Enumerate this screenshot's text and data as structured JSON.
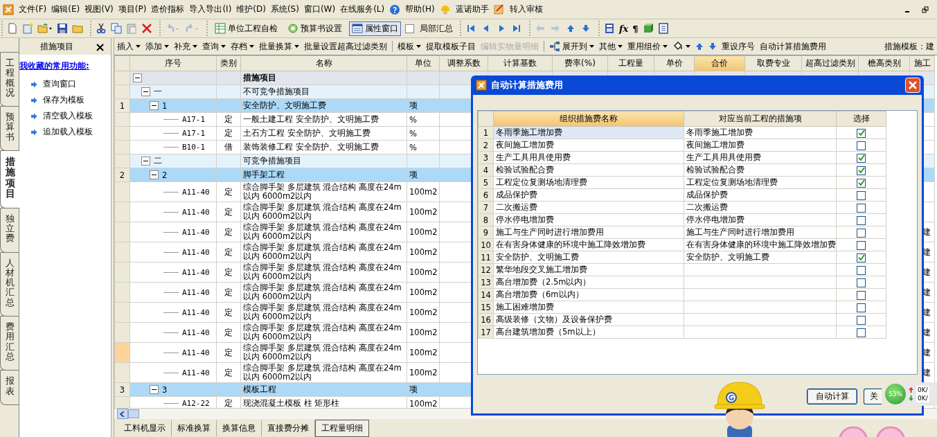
{
  "menu": {
    "items": [
      "文件(F)",
      "编辑(E)",
      "视图(V)",
      "项目(P)",
      "造价指标",
      "导入导出(I)",
      "维护(D)",
      "系统(S)",
      "窗口(W)",
      "在线服务(L)"
    ],
    "help": "帮助(H)",
    "assistant": "蓝诺助手",
    "review": "转入审核"
  },
  "toolbar": {
    "undo": {
      "disabled": true
    },
    "redo": {
      "disabled": true
    },
    "buttons": [
      {
        "label": "单位工程自检",
        "pressed": false
      },
      {
        "label": "预算书设置",
        "pressed": false
      },
      {
        "label": "属性窗口",
        "pressed": true
      }
    ],
    "summary_checkbox": {
      "label": "局部汇总",
      "checked": false
    },
    "back": {
      "disabled": true
    },
    "forward": {
      "disabled": true
    },
    "glyphs": [
      "fx",
      "¶"
    ]
  },
  "side_tabs": [
    {
      "label": "工程概况",
      "selected": false
    },
    {
      "label": "预算书",
      "selected": false
    },
    {
      "label": "措施项目",
      "selected": true
    },
    {
      "label": "独立费",
      "selected": false
    },
    {
      "label": "人材机汇总",
      "selected": false
    },
    {
      "label": "费用汇总",
      "selected": false
    },
    {
      "label": "报表",
      "selected": false
    }
  ],
  "left_panel": {
    "title": "措施项目",
    "close": "×",
    "heading": "我收藏的常用功能:",
    "items": [
      "查询窗口",
      "保存为模板",
      "清空载入模板",
      "追加载入模板"
    ]
  },
  "main_toolbar": {
    "items": [
      {
        "kind": "text",
        "label": "插入",
        "menu": true,
        "disabled": false
      },
      {
        "kind": "text",
        "label": "添加",
        "menu": true,
        "disabled": false
      },
      {
        "kind": "text",
        "label": "补充",
        "menu": true,
        "disabled": false
      },
      {
        "kind": "text",
        "label": "查询",
        "menu": true,
        "disabled": false
      },
      {
        "kind": "text",
        "label": "存档",
        "menu": true,
        "disabled": false
      },
      {
        "kind": "text",
        "label": "批量换算",
        "menu": true,
        "disabled": false
      },
      {
        "kind": "text",
        "label": "批量设置超高过滤类别",
        "menu": false,
        "disabled": false
      },
      {
        "kind": "text",
        "label": "模板",
        "menu": true,
        "disabled": false
      },
      {
        "kind": "text",
        "label": "提取模板子目",
        "menu": false,
        "disabled": false
      },
      {
        "kind": "text",
        "label": "编辑实物量明细",
        "menu": false,
        "disabled": true
      },
      {
        "kind": "tree",
        "label": "展开到",
        "menu": true,
        "disabled": false
      },
      {
        "kind": "text",
        "label": "其他",
        "menu": true,
        "disabled": false
      },
      {
        "kind": "text",
        "label": "重用组价",
        "menu": true,
        "disabled": false
      },
      {
        "kind": "fill",
        "menu": true,
        "disabled": false
      },
      {
        "kind": "up",
        "menu": false,
        "disabled": false
      },
      {
        "kind": "down",
        "menu": false,
        "disabled": false
      },
      {
        "kind": "text",
        "label": "重设序号",
        "menu": false,
        "disabled": false
      },
      {
        "kind": "text",
        "label": "自动计算措施费用",
        "menu": false,
        "disabled": false
      }
    ],
    "template_label": "措施模板：建"
  },
  "table": {
    "columns": [
      {
        "label": "序号",
        "selected": false
      },
      {
        "label": "类别",
        "selected": false
      },
      {
        "label": "名称",
        "selected": false
      },
      {
        "label": "单位",
        "selected": false
      },
      {
        "label": "调整系数",
        "selected": false
      },
      {
        "label": "计算基数",
        "selected": false
      },
      {
        "label": "费率(%)",
        "selected": false
      },
      {
        "label": "工程量",
        "selected": false
      },
      {
        "label": "单价",
        "selected": false
      },
      {
        "label": "合价",
        "selected": true
      },
      {
        "label": "取费专业",
        "selected": false
      },
      {
        "label": "超高过滤类别",
        "selected": false
      },
      {
        "label": "檐高类别",
        "selected": false
      },
      {
        "label": "施工",
        "selected": false
      }
    ],
    "rows": [
      {
        "name": "措施项目",
        "expanded": true,
        "selected": false,
        "children": [
          {
            "code": "一",
            "name": "不可竞争措施项目",
            "expanded": true,
            "selected": false,
            "children": [
              {
                "index": "1",
                "code": "1",
                "name": "安全防护、文明施工费",
                "unit": "项",
                "expanded": true,
                "selected": false,
                "children": [
                  {
                    "code": "A17-1",
                    "type": "定",
                    "name": "一般土建工程 安全防护、文明施工费",
                    "unit": "%",
                    "selected": false
                  },
                  {
                    "code": "A17-1",
                    "type": "定",
                    "name": "土石方工程 安全防护、文明施工费",
                    "unit": "%",
                    "selected": false
                  },
                  {
                    "code": "B10-1",
                    "type": "借",
                    "name": "装饰装修工程 安全防护、文明施工费",
                    "unit": "%",
                    "selected": false
                  }
                ]
              }
            ]
          },
          {
            "code": "二",
            "name": "可竞争措施项目",
            "expanded": true,
            "selected": false,
            "children": [
              {
                "index": "2",
                "code": "2",
                "name": "脚手架工程",
                "unit": "项",
                "expanded": true,
                "selected": false,
                "children": [
                  {
                    "code": "A11-40",
                    "type": "定",
                    "name": "综合脚手架 多层建筑 混合结构 高度在24m以内 6000m2以内",
                    "unit": "100m2",
                    "selected": false
                  },
                  {
                    "code": "A11-40",
                    "type": "定",
                    "name": "综合脚手架 多层建筑 混合结构 高度在24m以内 6000m2以内",
                    "unit": "100m2",
                    "selected": false
                  },
                  {
                    "code": "A11-40",
                    "type": "定",
                    "name": "综合脚手架 多层建筑 混合结构 高度在24m以内 6000m2以内",
                    "unit": "100m2",
                    "selected": false,
                    "column_14": "建"
                  },
                  {
                    "code": "A11-40",
                    "type": "定",
                    "name": "综合脚手架 多层建筑 混合结构 高度在24m以内 6000m2以内",
                    "unit": "100m2",
                    "selected": false,
                    "column_14": "建"
                  },
                  {
                    "code": "A11-40",
                    "type": "定",
                    "name": "综合脚手架 多层建筑 混合结构 高度在24m以内 6000m2以内",
                    "unit": "100m2",
                    "selected": false,
                    "column_14": "建"
                  },
                  {
                    "code": "A11-40",
                    "type": "定",
                    "name": "综合脚手架 多层建筑 混合结构 高度在24m以内 6000m2以内",
                    "unit": "100m2",
                    "selected": false,
                    "column_14": "建"
                  },
                  {
                    "code": "A11-40",
                    "type": "定",
                    "name": "综合脚手架 多层建筑 混合结构 高度在24m以内 6000m2以内",
                    "unit": "100m2",
                    "selected": false,
                    "column_14": "建"
                  },
                  {
                    "code": "A11-40",
                    "type": "定",
                    "name": "综合脚手架 多层建筑 混合结构 高度在24m以内 6000m2以内",
                    "unit": "100m2",
                    "selected": false,
                    "column_14": "建"
                  },
                  {
                    "code": "A11-40",
                    "type": "定",
                    "name": "综合脚手架 多层建筑 混合结构 高度在24m以内 6000m2以内",
                    "unit": "100m2",
                    "selected": true,
                    "column_14": "建"
                  },
                  {
                    "code": "A11-40",
                    "type": "定",
                    "name": "综合脚手架 多层建筑 混合结构 高度在24m以内 6000m2以内",
                    "unit": "100m2",
                    "selected": false,
                    "column_14": "建"
                  }
                ]
              },
              {
                "index": "3",
                "code": "3",
                "name": "模板工程",
                "unit": "项",
                "expanded": true,
                "selected": false,
                "children": [
                  {
                    "code": "A12-22",
                    "type": "定",
                    "name": "现浇混凝土模板 柱 矩形柱",
                    "unit": "100m2",
                    "selected": false
                  }
                ]
              }
            ]
          }
        ]
      }
    ]
  },
  "bottom_tabs": [
    {
      "label": "工料机显示",
      "selected": false
    },
    {
      "label": "标准换算",
      "selected": false
    },
    {
      "label": "换算信息",
      "selected": false
    },
    {
      "label": "直接费分摊",
      "selected": false
    },
    {
      "label": "工程量明细",
      "selected": true
    }
  ],
  "dialog": {
    "title": "自动计算措施费用",
    "columns": [
      {
        "label": "组织措施费名称",
        "selected": true
      },
      {
        "label": "对应当前工程的措施项",
        "selected": false
      },
      {
        "label": "选择",
        "selected": false
      }
    ],
    "rows": [
      {
        "no": "1",
        "name": "冬雨季施工增加费",
        "item": "冬雨季施工增加费",
        "checked": true,
        "selected": true
      },
      {
        "no": "2",
        "name": "夜间施工增加费",
        "item": "夜间施工增加费",
        "checked": false,
        "selected": false
      },
      {
        "no": "3",
        "name": "生产工具用具使用费",
        "item": "生产工具用具使用费",
        "checked": true,
        "selected": false
      },
      {
        "no": "4",
        "name": "检验试验配合费",
        "item": "检验试验配合费",
        "checked": true,
        "selected": false
      },
      {
        "no": "5",
        "name": "工程定位复测场地清理费",
        "item": "工程定位复测场地清理费",
        "checked": true,
        "selected": false
      },
      {
        "no": "6",
        "name": "成品保护费",
        "item": "成品保护费",
        "checked": false,
        "selected": false
      },
      {
        "no": "7",
        "name": "二次搬运费",
        "item": "二次搬运费",
        "checked": false,
        "selected": false
      },
      {
        "no": "8",
        "name": "停水停电增加费",
        "item": "停水停电增加费",
        "checked": false,
        "selected": false
      },
      {
        "no": "9",
        "name": "施工与生产同时进行增加费用",
        "item": "施工与生产同时进行增加费用",
        "checked": false,
        "selected": false
      },
      {
        "no": "10",
        "name": "在有害身体健康的环境中施工降效增加费",
        "item": "在有害身体健康的环境中施工降效增加费",
        "checked": false,
        "selected": false
      },
      {
        "no": "11",
        "name": "安全防护、文明施工费",
        "item": "安全防护、文明施工费",
        "checked": true,
        "selected": false
      },
      {
        "no": "12",
        "name": "繁华地段交叉施工增加费",
        "checked": false,
        "selected": false
      },
      {
        "no": "13",
        "name": "高台增加费（2.5m以内）",
        "checked": false,
        "selected": false
      },
      {
        "no": "14",
        "name": "高台增加费（6m以内）",
        "checked": false,
        "selected": false
      },
      {
        "no": "15",
        "name": "施工困难增加费",
        "checked": false,
        "selected": false
      },
      {
        "no": "16",
        "name": "高级装修（文物）及设备保护费",
        "checked": false,
        "selected": false
      },
      {
        "no": "17",
        "name": "高台建筑增加费（5m以上）",
        "checked": false,
        "selected": false
      }
    ],
    "buttons": [
      "自动计算",
      "关"
    ]
  },
  "mascot": {
    "badge": "G"
  },
  "network": {
    "percent": "53%",
    "up": "0K/",
    "down": "0K/"
  }
}
